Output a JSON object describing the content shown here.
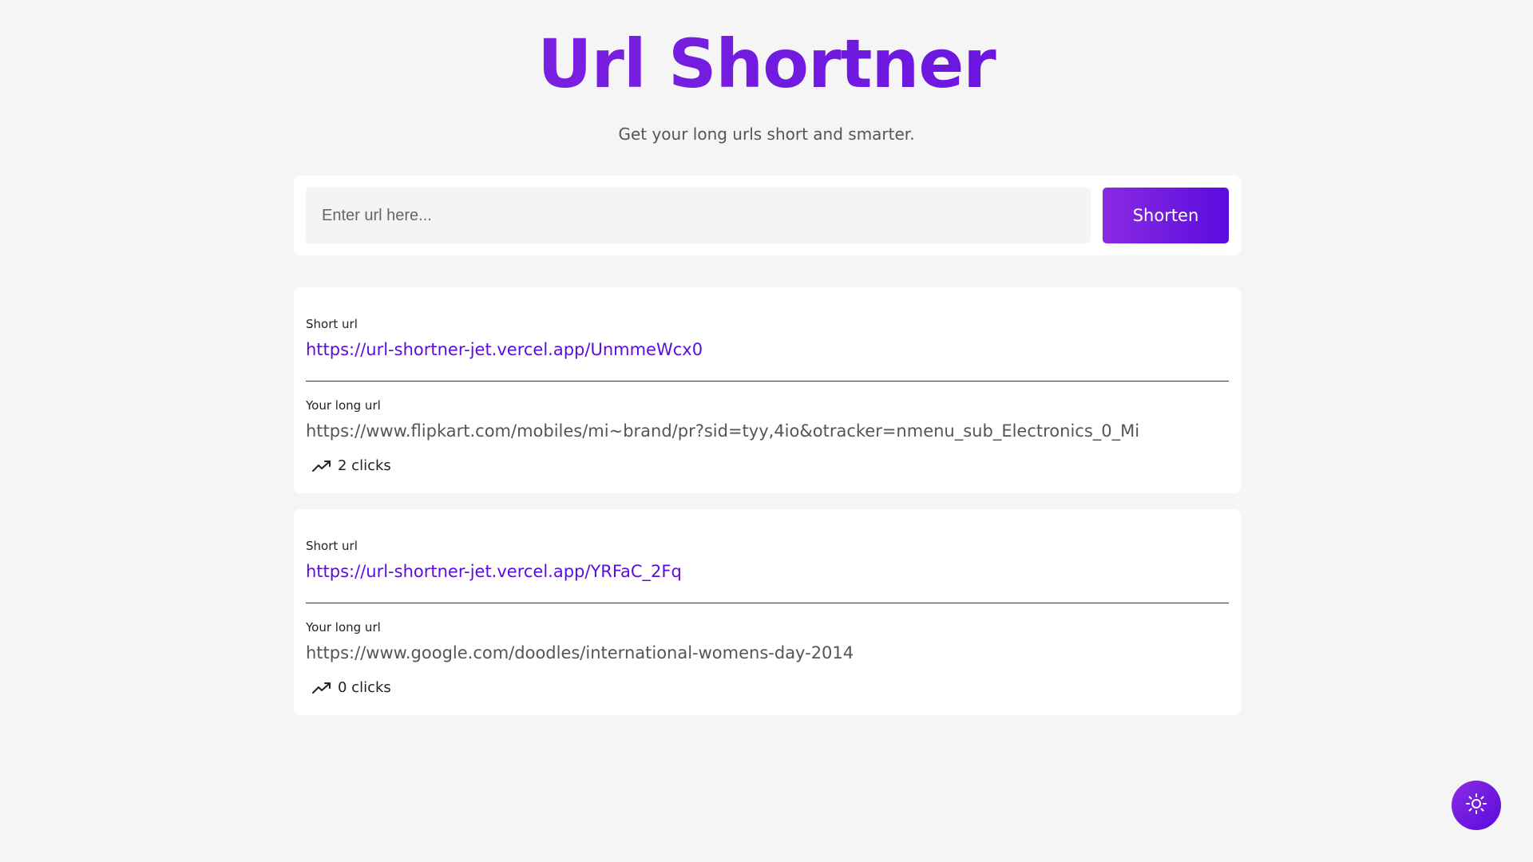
{
  "header": {
    "title": "Url Shortner",
    "subtitle": "Get your long urls short and smarter."
  },
  "form": {
    "placeholder": "Enter url here...",
    "value": "",
    "button_label": "Shorten"
  },
  "results": [
    {
      "short_label": "Short url",
      "short_url": "https://url-shortner-jet.vercel.app/UnmmeWcx0",
      "long_label": "Your long url",
      "long_url": "https://www.flipkart.com/mobiles/mi~brand/pr?sid=tyy,4io&otracker=nmenu_sub_Electronics_0_Mi",
      "clicks": "2 clicks"
    },
    {
      "short_label": "Short url",
      "short_url": "https://url-shortner-jet.vercel.app/YRFaC_2Fq",
      "long_label": "Your long url",
      "long_url": "https://www.google.com/doodles/international-womens-day-2014",
      "clicks": "0 clicks"
    }
  ],
  "icons": {
    "clicks": "trending-up-icon",
    "theme_toggle": "sun-icon"
  },
  "colors": {
    "accent_start": "#8a2be2",
    "accent_end": "#5b0bde",
    "link": "#5b0bde",
    "background": "#f5f5f5",
    "card": "#ffffff"
  }
}
